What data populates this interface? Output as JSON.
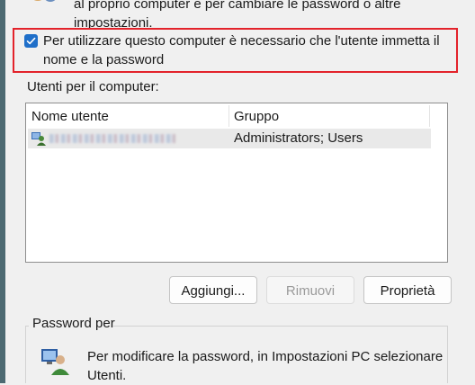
{
  "header": {
    "line1": "al proprio computer e per cambiare le password o altre",
    "line2": "impostazioni."
  },
  "require_login": {
    "checked": true,
    "label": "Per utilizzare questo computer è necessario che l'utente immetta il nome e la password"
  },
  "users_group": {
    "label": "Utenti per il computer:",
    "columns": [
      "Nome utente",
      "Gruppo"
    ],
    "rows": [
      {
        "name": "",
        "group": "Administrators; Users"
      }
    ]
  },
  "buttons": {
    "add": "Aggiungi...",
    "remove": "Rimuovi",
    "properties": "Proprietà"
  },
  "password_section": {
    "label": "Password per",
    "text": "Per modificare la password, in Impostazioni PC selezionare Utenti."
  },
  "colors": {
    "highlight": "#e3232b",
    "checkbox": "#1f6fc9",
    "background": "#f0f0f0"
  }
}
